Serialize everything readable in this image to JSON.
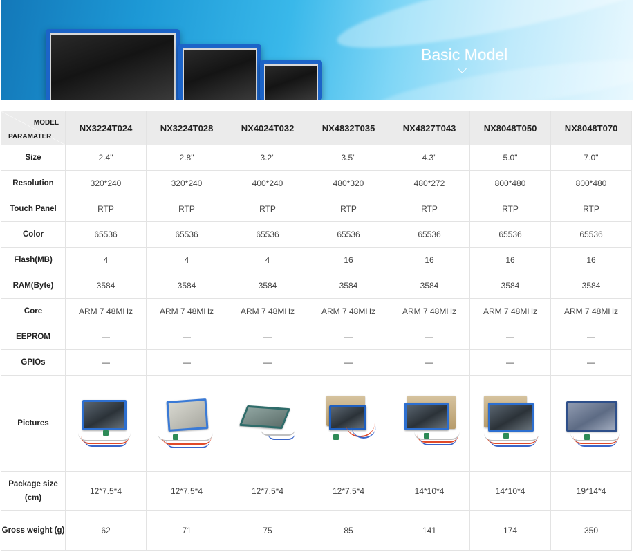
{
  "banner": {
    "title": "Basic Model"
  },
  "table": {
    "corner_model": "MODEL",
    "corner_param": "PARAMATER",
    "models": [
      "NX3224T024",
      "NX3224T028",
      "NX4024T032",
      "NX4832T035",
      "NX4827T043",
      "NX8048T050",
      "NX8048T070"
    ],
    "rows": [
      {
        "label": "Size",
        "values": [
          "2.4\"",
          "2.8\"",
          "3.2\"",
          "3.5\"",
          "4.3\"",
          "5.0\"",
          "7.0\""
        ]
      },
      {
        "label": "Resolution",
        "values": [
          "320*240",
          "320*240",
          "400*240",
          "480*320",
          "480*272",
          "800*480",
          "800*480"
        ]
      },
      {
        "label": "Touch Panel",
        "values": [
          "RTP",
          "RTP",
          "RTP",
          "RTP",
          "RTP",
          "RTP",
          "RTP"
        ]
      },
      {
        "label": "Color",
        "values": [
          "65536",
          "65536",
          "65536",
          "65536",
          "65536",
          "65536",
          "65536"
        ]
      },
      {
        "label": "Flash(MB)",
        "values": [
          "4",
          "4",
          "4",
          "16",
          "16",
          "16",
          "16"
        ]
      },
      {
        "label": "RAM(Byte)",
        "values": [
          "3584",
          "3584",
          "3584",
          "3584",
          "3584",
          "3584",
          "3584"
        ]
      },
      {
        "label": "Core",
        "values": [
          "ARM 7 48MHz",
          "ARM 7 48MHz",
          "ARM 7 48MHz",
          "ARM 7 48MHz",
          "ARM 7 48MHz",
          "ARM 7 48MHz",
          "ARM 7 48MHz"
        ]
      },
      {
        "label": "EEPROM",
        "values": [
          "—",
          "—",
          "—",
          "—",
          "—",
          "—",
          "—"
        ]
      },
      {
        "label": "GPIOs",
        "values": [
          "—",
          "—",
          "—",
          "—",
          "—",
          "—",
          "—"
        ]
      }
    ],
    "pictures_label": "Pictures",
    "bottom_rows": [
      {
        "label": "Package size (cm)",
        "values": [
          "12*7.5*4",
          "12*7.5*4",
          "12*7.5*4",
          "12*7.5*4",
          "14*10*4",
          "14*10*4",
          "19*14*4"
        ]
      },
      {
        "label": "Gross weight (g)",
        "values": [
          "62",
          "71",
          "75",
          "85",
          "141",
          "174",
          "350"
        ]
      }
    ]
  }
}
